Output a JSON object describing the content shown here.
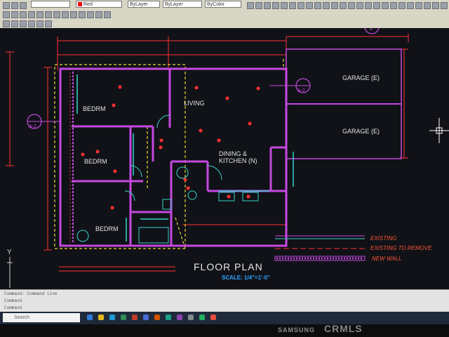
{
  "toolbar": {
    "layer_select": "Red",
    "bylayer_1": "ByLayer",
    "bylayer_2": "ByLayer",
    "bycolor": "ByColor"
  },
  "drawing": {
    "rooms": {
      "bedroom_1": "BEDRM",
      "bedroom_2": "BEDRM",
      "bedroom_3": "BEDRM",
      "living": "LIVING",
      "dining_line1": "DINING &",
      "dining_line2": "KITCHEN (N)",
      "garage_1": "GARAGE (E)",
      "garage_2": "GARAGE (E)"
    },
    "title": "FLOOR PLAN",
    "scale": "SCALE: 1/4\"=1'-0\"",
    "callouts": {
      "section_top": "2",
      "section_left": "A-2",
      "section_right": "A-2"
    },
    "legend": {
      "existing": "EXISTING",
      "existing_remove": "EXISTING TO REMOVE",
      "new_wall": "NEW WALL"
    },
    "axis_y": "Y",
    "colors": {
      "new_wall": "#c648e0",
      "dimension": "#ff3030",
      "existing": "#39d2c8",
      "remove": "#f0d830",
      "text": "#e6e6e6",
      "scale_text": "#2aa8ff",
      "legend_text": "#ff5533"
    }
  },
  "command": {
    "line1": "Command: Command Line",
    "line2": "Command",
    "line3": "Command"
  },
  "taskbar": {
    "search": "Search"
  },
  "bezel": {
    "brand": "SAMSUNG",
    "watermark": "CRMLS"
  }
}
